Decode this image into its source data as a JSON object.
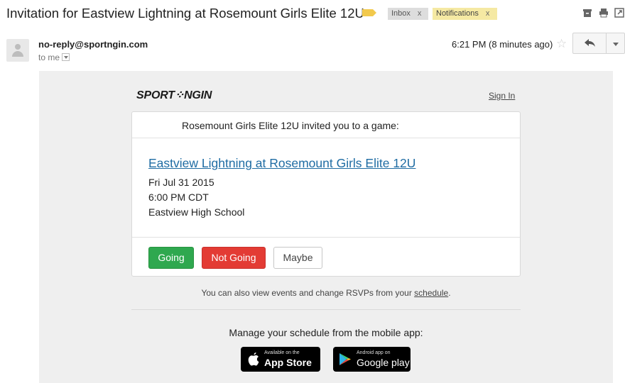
{
  "subject": {
    "title": "Invitation for Eastview Lightning at Rosemount Girls Elite 12U",
    "labels": [
      {
        "name": "Inbox",
        "remove": "x"
      },
      {
        "name": "Notifications",
        "remove": "x"
      }
    ]
  },
  "toolbar": {
    "icons": [
      "archive-icon",
      "print-icon",
      "new-window-icon"
    ]
  },
  "message": {
    "sender": "no-reply@sportngin.com",
    "recipient": "to me",
    "time": "6:21 PM (8 minutes ago)",
    "star": "☆",
    "reply_icon": "reply-icon",
    "more_icon": "more-options-icon"
  },
  "email": {
    "brand": "SPORT::NGIN",
    "brand_left": "SPORT",
    "brand_mark": "⁘",
    "brand_right": "NGIN",
    "sign_in": "Sign In",
    "invite_text": "Rosemount Girls Elite 12U invited you to a game:",
    "event_title": "Eastview Lightning at Rosemount Girls Elite 12U",
    "date": "Fri Jul 31 2015",
    "time": "6:00 PM CDT",
    "location": "Eastview High School",
    "buttons": {
      "going": "Going",
      "not_going": "Not Going",
      "maybe": "Maybe"
    },
    "view_note_prefix": "You can also view events and change RSVPs from your ",
    "view_note_link": "schedule",
    "view_note_suffix": ".",
    "manage_text": "Manage your schedule from the mobile app:",
    "app_store": {
      "small": "Available on the",
      "big": "App Store"
    },
    "google_play": {
      "small": "Android app on",
      "big": "Google play"
    }
  },
  "colors": {
    "going": "#2fa84f",
    "not_going": "#e33b34",
    "link": "#1f6ca3",
    "notifications_label": "#f5e9a3",
    "important_marker": "#f2c94c"
  }
}
